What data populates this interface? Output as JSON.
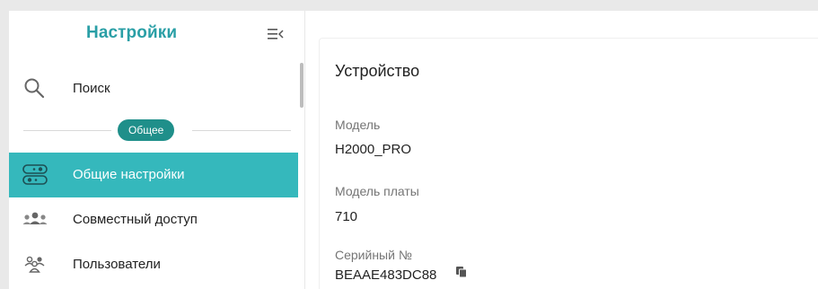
{
  "sidebar": {
    "title": "Настройки",
    "collapse_icon": "menu-collapse-icon",
    "search": {
      "label": "Поиск",
      "icon": "search-icon"
    },
    "group": {
      "label": "Общее"
    },
    "items": [
      {
        "label": "Общие настройки",
        "icon": "toggles-icon",
        "active": true
      },
      {
        "label": "Совместный доступ",
        "icon": "people-group-icon",
        "active": false
      },
      {
        "label": "Пользователи",
        "icon": "users-icon",
        "active": false
      }
    ]
  },
  "device": {
    "title": "Устройство",
    "model_label": "Модель",
    "model_value": "H2000_PRO",
    "board_label": "Модель платы",
    "board_value": "710",
    "serial_label": "Серийный №",
    "serial_value": "BEAAE483DC88"
  },
  "colors": {
    "accent": "#35b8bc",
    "title_teal": "#2a9fa6",
    "badge": "#1f8f8a"
  }
}
